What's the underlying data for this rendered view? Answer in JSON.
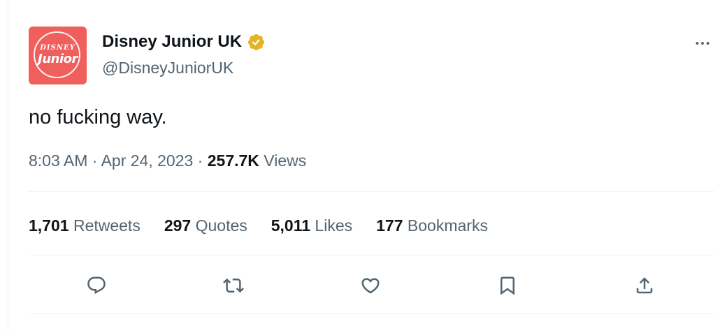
{
  "author": {
    "display_name": "Disney Junior UK",
    "handle": "@DisneyJuniorUK",
    "avatar_text_small": "DISNEY",
    "avatar_text_big": "Junior",
    "avatar_color": "#ef5f5c",
    "verified_badge_color": "#e6b325"
  },
  "tweet": {
    "text": "no fucking way."
  },
  "meta": {
    "time": "8:03 AM",
    "separator1": " · ",
    "date": "Apr 24, 2023",
    "separator2": " · ",
    "views_count": "257.7K",
    "views_label": " Views"
  },
  "stats": [
    {
      "count": "1,701",
      "label": " Retweets"
    },
    {
      "count": "297",
      "label": " Quotes"
    },
    {
      "count": "5,011",
      "label": " Likes"
    },
    {
      "count": "177",
      "label": " Bookmarks"
    }
  ],
  "actions": [
    {
      "icon": "reply-icon"
    },
    {
      "icon": "retweet-icon"
    },
    {
      "icon": "like-icon"
    },
    {
      "icon": "bookmark-icon"
    },
    {
      "icon": "share-icon"
    }
  ],
  "more_icon": "more-icon"
}
